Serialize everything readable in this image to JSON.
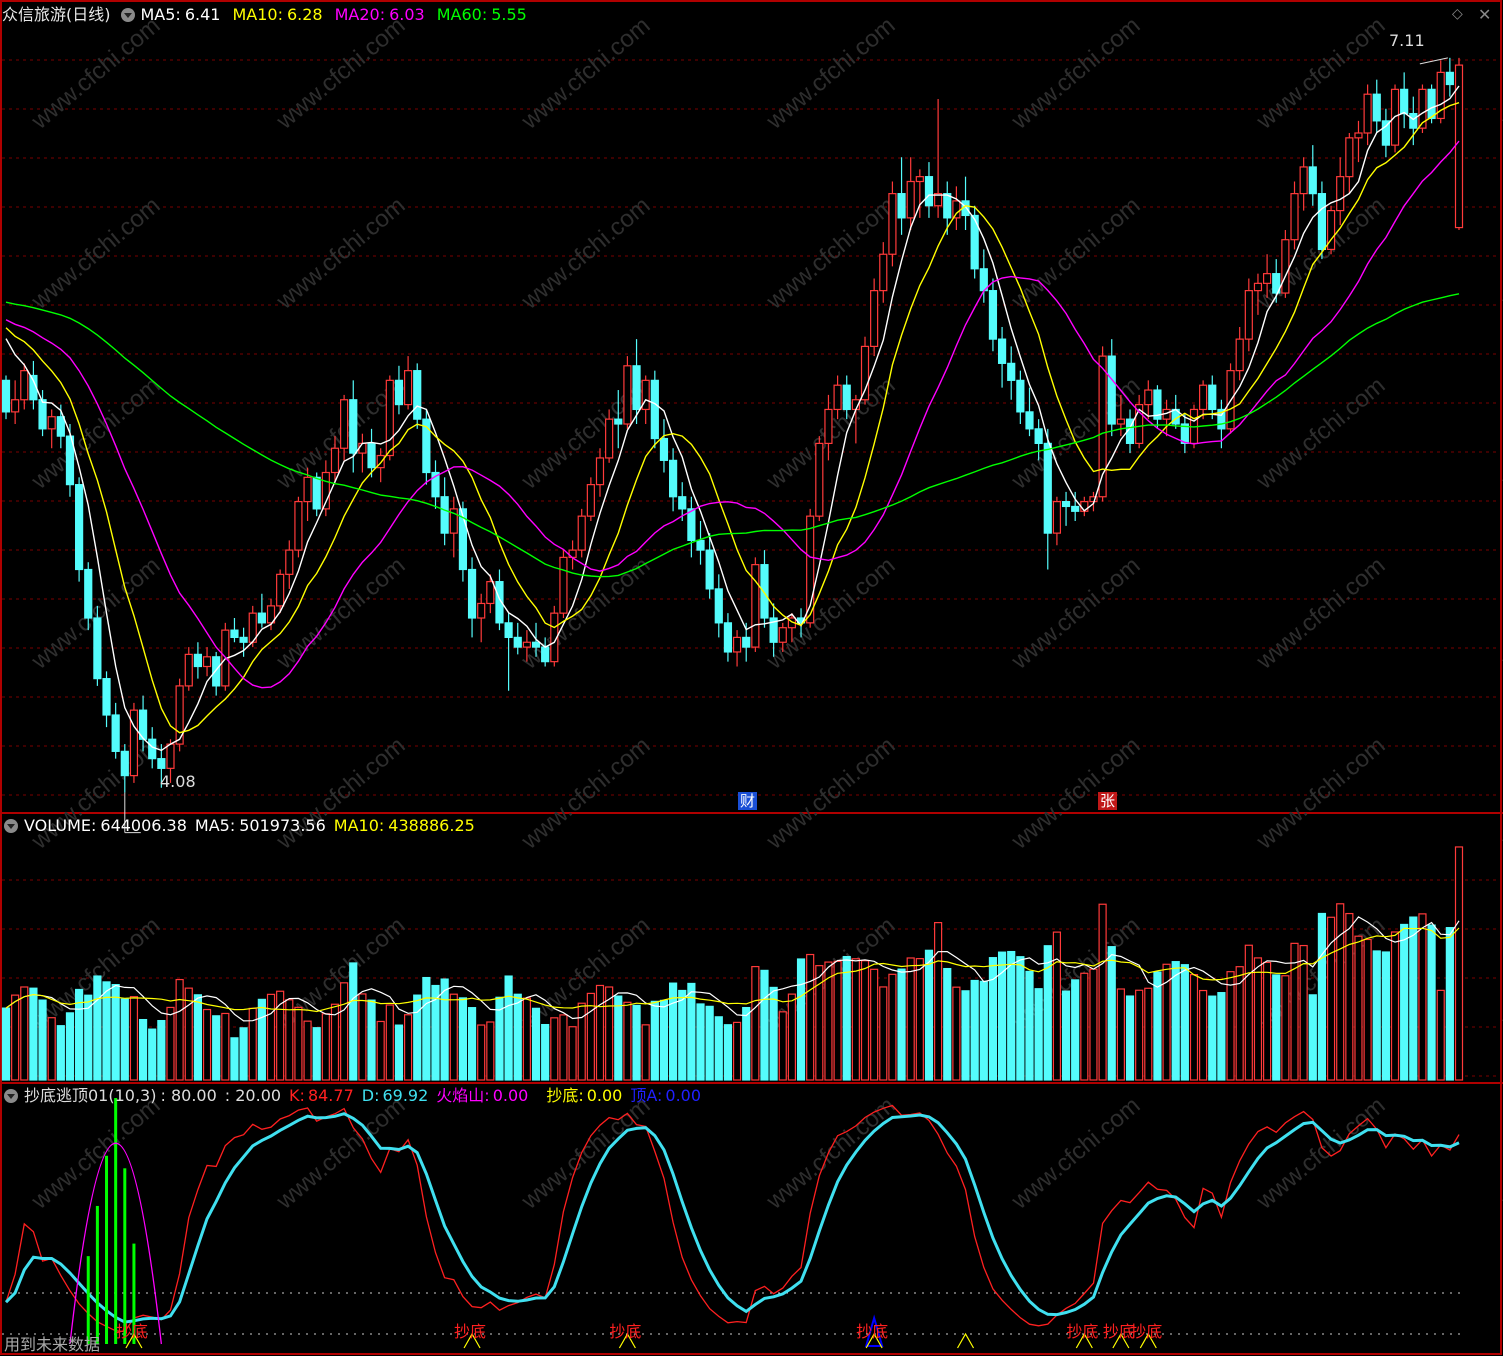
{
  "price_panel": {
    "title": "众信旅游(日线)",
    "ma5_label": "MA5:",
    "ma5_value": "6.41",
    "ma10_label": "MA10:",
    "ma10_value": "6.28",
    "ma20_label": "MA20:",
    "ma20_value": "6.03",
    "ma60_label": "MA60:",
    "ma60_value": "5.55",
    "high_label": "7.11",
    "low_label": "4.08",
    "event_marker_1": "财",
    "event_marker_2": "张"
  },
  "volume_panel": {
    "volume_label": "VOLUME:",
    "volume_value": "644006.38",
    "ma5_label": "MA5:",
    "ma5_value": "501973.56",
    "ma10_label": "MA10:",
    "ma10_value": "438886.25"
  },
  "indicator_panel": {
    "name": "抄底逃顶01(10,3)",
    "level_high": ": 80.00",
    "level_low": ": 20.00",
    "k_label": "K:",
    "k_value": "84.77",
    "d_label": "D:",
    "d_value": "69.92",
    "fire_label": "火焰山:",
    "fire_value": "0.00",
    "bottom_label": "抄底:",
    "bottom_value": "0.00",
    "top_label": "顶A:",
    "top_value": "0.00",
    "signal_label": "抄底",
    "footer_text": "用到未来数据"
  },
  "colors": {
    "up": "#ff3a3a",
    "down": "#54fcfc",
    "ma5": "#ffffff",
    "ma10": "#ffff00",
    "ma20": "#ff00ff",
    "ma60": "#00ff00",
    "grid": "#7a0000",
    "frame": "#b00000",
    "k_line": "#ff2020",
    "d_line": "#40e0f0",
    "fire": "#00ff00",
    "top_signal": "#0000ff"
  },
  "watermark": "www.cfchi.com",
  "chart_data": [
    {
      "type": "candlestick",
      "title": "众信旅游(日线)",
      "ylim": [
        4.0,
        7.2
      ],
      "annotations": [
        {
          "label": "7.11",
          "type": "period-high"
        },
        {
          "label": "4.08",
          "type": "period-low"
        }
      ],
      "series": [
        {
          "name": "MA5",
          "last": 6.41
        },
        {
          "name": "MA10",
          "last": 6.28
        },
        {
          "name": "MA20",
          "last": 6.03
        },
        {
          "name": "MA60",
          "last": 5.55
        }
      ],
      "ohlc": [
        [
          5.78,
          5.8,
          5.62,
          5.65
        ],
        [
          5.65,
          5.78,
          5.6,
          5.7
        ],
        [
          5.7,
          5.85,
          5.66,
          5.82
        ],
        [
          5.8,
          5.86,
          5.66,
          5.7
        ],
        [
          5.7,
          5.74,
          5.55,
          5.58
        ],
        [
          5.58,
          5.66,
          5.5,
          5.63
        ],
        [
          5.63,
          5.68,
          5.5,
          5.55
        ],
        [
          5.55,
          5.6,
          5.3,
          5.35
        ],
        [
          5.35,
          5.38,
          4.95,
          5.0
        ],
        [
          5.0,
          5.03,
          4.75,
          4.8
        ],
        [
          4.8,
          4.85,
          4.52,
          4.55
        ],
        [
          4.55,
          4.58,
          4.35,
          4.4
        ],
        [
          4.4,
          4.45,
          4.22,
          4.25
        ],
        [
          4.25,
          4.28,
          4.08,
          4.15
        ],
        [
          4.15,
          4.45,
          4.12,
          4.42
        ],
        [
          4.42,
          4.48,
          4.25,
          4.3
        ],
        [
          4.3,
          4.35,
          4.18,
          4.22
        ],
        [
          4.22,
          4.28,
          4.1,
          4.18
        ],
        [
          4.18,
          4.3,
          4.12,
          4.28
        ],
        [
          4.28,
          4.55,
          4.25,
          4.52
        ],
        [
          4.52,
          4.68,
          4.5,
          4.65
        ],
        [
          4.65,
          4.7,
          4.55,
          4.6
        ],
        [
          4.6,
          4.68,
          4.56,
          4.64
        ],
        [
          4.64,
          4.66,
          4.48,
          4.52
        ],
        [
          4.52,
          4.78,
          4.5,
          4.75
        ],
        [
          4.75,
          4.8,
          4.7,
          4.72
        ],
        [
          4.72,
          4.76,
          4.64,
          4.7
        ],
        [
          4.7,
          4.85,
          4.68,
          4.82
        ],
        [
          4.82,
          4.9,
          4.76,
          4.78
        ],
        [
          4.78,
          4.88,
          4.75,
          4.85
        ],
        [
          4.85,
          5.0,
          4.82,
          4.98
        ],
        [
          4.98,
          5.12,
          4.92,
          5.08
        ],
        [
          5.08,
          5.3,
          5.05,
          5.28
        ],
        [
          5.28,
          5.42,
          5.2,
          5.38
        ],
        [
          5.38,
          5.4,
          5.22,
          5.25
        ],
        [
          5.25,
          5.45,
          5.22,
          5.4
        ],
        [
          5.4,
          5.55,
          5.35,
          5.5
        ],
        [
          5.5,
          5.72,
          5.45,
          5.7
        ],
        [
          5.7,
          5.78,
          5.4,
          5.48
        ],
        [
          5.48,
          5.56,
          5.4,
          5.52
        ],
        [
          5.52,
          5.58,
          5.38,
          5.42
        ],
        [
          5.42,
          5.5,
          5.36,
          5.47
        ],
        [
          5.47,
          5.8,
          5.45,
          5.78
        ],
        [
          5.78,
          5.84,
          5.64,
          5.68
        ],
        [
          5.68,
          5.88,
          5.66,
          5.82
        ],
        [
          5.82,
          5.85,
          5.58,
          5.62
        ],
        [
          5.62,
          5.66,
          5.35,
          5.4
        ],
        [
          5.4,
          5.45,
          5.25,
          5.3
        ],
        [
          5.3,
          5.38,
          5.1,
          5.15
        ],
        [
          5.15,
          5.3,
          5.05,
          5.25
        ],
        [
          5.25,
          5.28,
          4.95,
          5.0
        ],
        [
          5.0,
          5.05,
          4.72,
          4.8
        ],
        [
          4.8,
          4.9,
          4.7,
          4.86
        ],
        [
          4.86,
          4.98,
          4.82,
          4.95
        ],
        [
          4.95,
          5.0,
          4.75,
          4.78
        ],
        [
          4.78,
          4.82,
          4.5,
          4.72
        ],
        [
          4.72,
          4.78,
          4.65,
          4.68
        ],
        [
          4.68,
          4.75,
          4.62,
          4.7
        ],
        [
          4.7,
          4.78,
          4.64,
          4.68
        ],
        [
          4.68,
          4.72,
          4.6,
          4.62
        ],
        [
          4.62,
          4.85,
          4.6,
          4.82
        ],
        [
          4.82,
          5.08,
          4.8,
          5.05
        ],
        [
          5.05,
          5.12,
          5.0,
          5.08
        ],
        [
          5.08,
          5.25,
          5.05,
          5.22
        ],
        [
          5.22,
          5.38,
          5.2,
          5.35
        ],
        [
          5.35,
          5.5,
          5.3,
          5.46
        ],
        [
          5.46,
          5.66,
          5.44,
          5.62
        ],
        [
          5.62,
          5.74,
          5.5,
          5.6
        ],
        [
          5.6,
          5.88,
          5.58,
          5.84
        ],
        [
          5.84,
          5.95,
          5.6,
          5.66
        ],
        [
          5.66,
          5.8,
          5.6,
          5.78
        ],
        [
          5.78,
          5.82,
          5.5,
          5.54
        ],
        [
          5.54,
          5.62,
          5.4,
          5.45
        ],
        [
          5.45,
          5.5,
          5.24,
          5.3
        ],
        [
          5.3,
          5.36,
          5.2,
          5.25
        ],
        [
          5.25,
          5.3,
          5.05,
          5.12
        ],
        [
          5.12,
          5.2,
          5.02,
          5.08
        ],
        [
          5.08,
          5.15,
          4.88,
          4.92
        ],
        [
          4.92,
          4.98,
          4.72,
          4.78
        ],
        [
          4.78,
          4.82,
          4.62,
          4.66
        ],
        [
          4.66,
          4.75,
          4.6,
          4.72
        ],
        [
          4.72,
          4.78,
          4.62,
          4.68
        ],
        [
          4.68,
          5.05,
          4.66,
          5.02
        ],
        [
          5.02,
          5.08,
          4.76,
          4.8
        ],
        [
          4.8,
          4.86,
          4.64,
          4.7
        ],
        [
          4.7,
          4.78,
          4.66,
          4.76
        ],
        [
          4.76,
          4.82,
          4.7,
          4.8
        ],
        [
          4.8,
          4.84,
          4.72,
          4.78
        ],
        [
          4.78,
          5.25,
          4.76,
          5.22
        ],
        [
          5.22,
          5.55,
          5.2,
          5.52
        ],
        [
          5.52,
          5.72,
          5.45,
          5.66
        ],
        [
          5.66,
          5.8,
          5.62,
          5.76
        ],
        [
          5.76,
          5.8,
          5.62,
          5.66
        ],
        [
          5.66,
          5.72,
          5.52,
          5.7
        ],
        [
          5.7,
          5.96,
          5.68,
          5.92
        ],
        [
          5.92,
          6.2,
          5.88,
          6.15
        ],
        [
          6.15,
          6.35,
          6.1,
          6.3
        ],
        [
          6.3,
          6.6,
          6.25,
          6.55
        ],
        [
          6.55,
          6.7,
          6.38,
          6.45
        ],
        [
          6.45,
          6.7,
          6.4,
          6.6
        ],
        [
          6.6,
          6.65,
          6.45,
          6.62
        ],
        [
          6.62,
          6.68,
          6.45,
          6.5
        ],
        [
          6.5,
          6.94,
          6.45,
          6.55
        ],
        [
          6.55,
          6.6,
          6.38,
          6.45
        ],
        [
          6.45,
          6.58,
          6.4,
          6.52
        ],
        [
          6.52,
          6.62,
          6.4,
          6.46
        ],
        [
          6.46,
          6.5,
          6.2,
          6.24
        ],
        [
          6.24,
          6.32,
          6.1,
          6.15
        ],
        [
          6.15,
          6.2,
          5.9,
          5.95
        ],
        [
          5.95,
          6.0,
          5.75,
          5.85
        ],
        [
          5.85,
          5.92,
          5.7,
          5.78
        ],
        [
          5.78,
          5.82,
          5.6,
          5.65
        ],
        [
          5.65,
          5.75,
          5.55,
          5.58
        ],
        [
          5.58,
          5.62,
          5.45,
          5.52
        ],
        [
          5.52,
          5.58,
          5.0,
          5.15
        ],
        [
          5.15,
          5.3,
          5.1,
          5.28
        ],
        [
          5.28,
          5.32,
          5.18,
          5.26
        ],
        [
          5.26,
          5.32,
          5.2,
          5.24
        ],
        [
          5.24,
          5.3,
          5.22,
          5.28
        ],
        [
          5.28,
          5.32,
          5.24,
          5.3
        ],
        [
          5.3,
          5.92,
          5.28,
          5.88
        ],
        [
          5.88,
          5.95,
          5.55,
          5.6
        ],
        [
          5.6,
          5.72,
          5.55,
          5.62
        ],
        [
          5.62,
          5.66,
          5.48,
          5.52
        ],
        [
          5.52,
          5.72,
          5.5,
          5.68
        ],
        [
          5.68,
          5.78,
          5.62,
          5.74
        ],
        [
          5.74,
          5.76,
          5.58,
          5.62
        ],
        [
          5.62,
          5.7,
          5.55,
          5.66
        ],
        [
          5.66,
          5.72,
          5.58,
          5.6
        ],
        [
          5.6,
          5.64,
          5.48,
          5.52
        ],
        [
          5.52,
          5.68,
          5.5,
          5.66
        ],
        [
          5.66,
          5.78,
          5.62,
          5.76
        ],
        [
          5.76,
          5.8,
          5.62,
          5.66
        ],
        [
          5.66,
          5.7,
          5.5,
          5.58
        ],
        [
          5.58,
          5.85,
          5.56,
          5.82
        ],
        [
          5.82,
          6.0,
          5.78,
          5.95
        ],
        [
          5.95,
          6.2,
          5.9,
          6.15
        ],
        [
          6.15,
          6.22,
          6.05,
          6.18
        ],
        [
          6.18,
          6.3,
          6.12,
          6.22
        ],
        [
          6.22,
          6.28,
          6.1,
          6.14
        ],
        [
          6.14,
          6.4,
          6.12,
          6.36
        ],
        [
          6.36,
          6.6,
          6.32,
          6.55
        ],
        [
          6.55,
          6.7,
          6.48,
          6.66
        ],
        [
          6.66,
          6.75,
          6.5,
          6.55
        ],
        [
          6.55,
          6.6,
          6.28,
          6.32
        ],
        [
          6.32,
          6.5,
          6.3,
          6.48
        ],
        [
          6.48,
          6.7,
          6.42,
          6.62
        ],
        [
          6.62,
          6.8,
          6.55,
          6.78
        ],
        [
          6.78,
          6.85,
          6.68,
          6.8
        ],
        [
          6.8,
          7.0,
          6.75,
          6.96
        ],
        [
          6.96,
          7.02,
          6.8,
          6.85
        ],
        [
          6.85,
          6.9,
          6.7,
          6.75
        ],
        [
          6.75,
          7.0,
          6.72,
          6.98
        ],
        [
          6.98,
          7.05,
          6.82,
          6.88
        ],
        [
          6.88,
          6.95,
          6.75,
          6.82
        ],
        [
          6.82,
          7.0,
          6.8,
          6.98
        ],
        [
          6.98,
          7.0,
          6.84,
          6.86
        ],
        [
          6.86,
          7.1,
          6.84,
          7.05
        ],
        [
          7.05,
          7.11,
          6.95,
          7.0
        ],
        [
          6.41,
          7.11,
          6.4,
          7.08
        ]
      ]
    },
    {
      "type": "bar",
      "title": "VOLUME",
      "series": [
        {
          "name": "VOLUME",
          "last": 644006.38
        },
        {
          "name": "MA5",
          "last": 501973.56
        },
        {
          "name": "MA10",
          "last": 438886.25
        }
      ]
    },
    {
      "type": "line",
      "title": "抄底逃顶01(10,3)",
      "ylim": [
        0,
        100
      ],
      "levels": [
        80,
        20
      ],
      "series": [
        {
          "name": "K",
          "last": 84.77
        },
        {
          "name": "D",
          "last": 69.92
        },
        {
          "name": "火焰山",
          "last": 0.0
        },
        {
          "name": "抄底",
          "last": 0.0
        },
        {
          "name": "顶A",
          "last": 0.0
        }
      ],
      "signal_positions": [
        14,
        51,
        68,
        95,
        105,
        118,
        122,
        125
      ]
    }
  ]
}
